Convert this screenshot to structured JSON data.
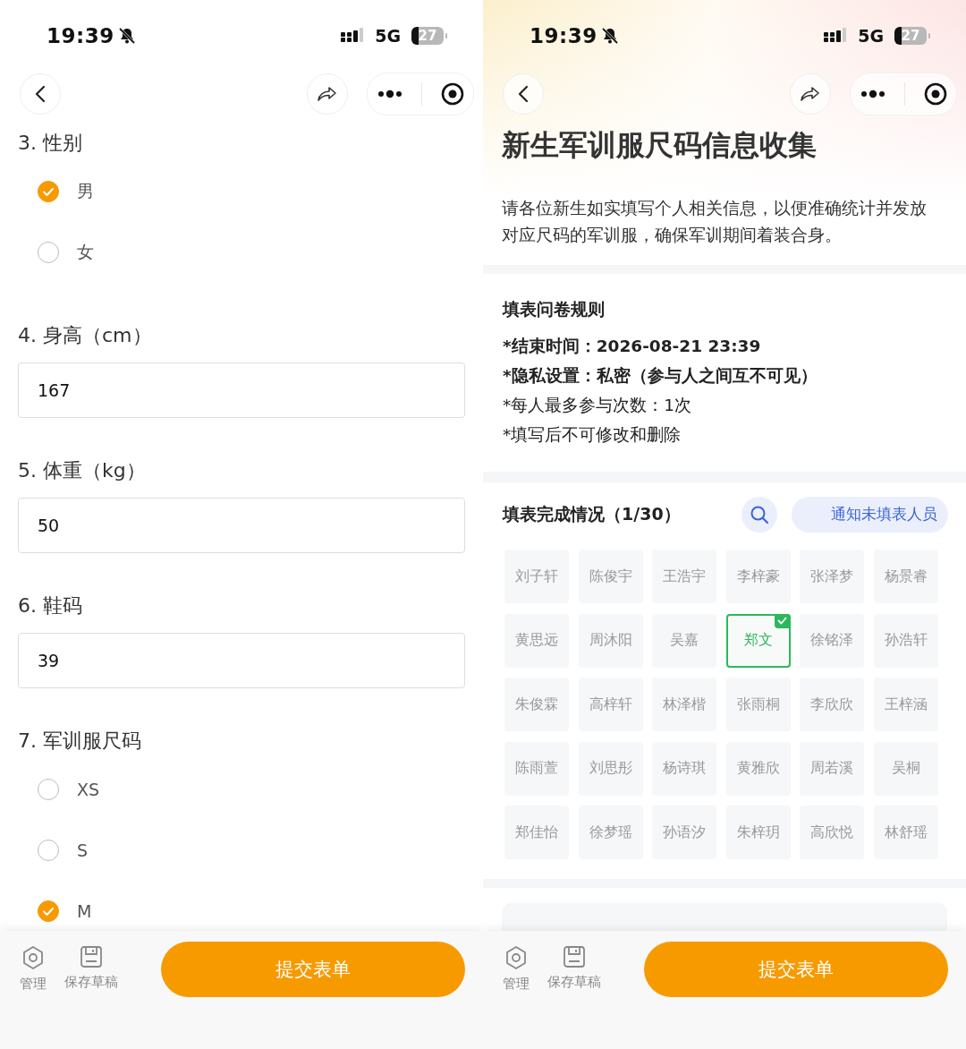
{
  "form_screen": {
    "status_bar": {
      "time": "19:39",
      "network": "5G",
      "battery": "27"
    },
    "questions": [
      {
        "kind": "radio",
        "label": "3. 性别",
        "options": [
          {
            "label": "男",
            "selected": true
          },
          {
            "label": "女",
            "selected": false
          }
        ]
      },
      {
        "kind": "input",
        "label": "4. 身高（cm）",
        "value": "167"
      },
      {
        "kind": "input",
        "label": "5. 体重（kg）",
        "value": "50"
      },
      {
        "kind": "input",
        "label": "6. 鞋码",
        "value": "39"
      },
      {
        "kind": "radio",
        "label": "7. 军训服尺码",
        "options": [
          {
            "label": "XS",
            "selected": false
          },
          {
            "label": "S",
            "selected": false
          },
          {
            "label": "M",
            "selected": true
          }
        ]
      }
    ],
    "bottom_bar": {
      "actions": [
        {
          "kind": "settings",
          "label": "管理"
        },
        {
          "kind": "save",
          "label": "保存草稿"
        }
      ],
      "submit": "提交表单"
    }
  },
  "info_screen": {
    "status_bar": {
      "time": "19:39",
      "network": "5G",
      "battery": "27"
    },
    "title": "新生军训服尺码信息收集",
    "description": "请各位新生如实填写个人相关信息，以便准确统计并发放对应尺码的军训服，确保军训期间着装合身。",
    "rules": {
      "title": "填表问卷规则",
      "items": [
        {
          "label": "*结束时间：",
          "value": "2026-08-21 23:39",
          "bold": true
        },
        {
          "label": "*隐私设置：",
          "value": "私密（参与人之间互不可见）",
          "bold": true
        },
        {
          "label": "*每人最多参与次数：",
          "value": "1次",
          "bold": false
        },
        {
          "label": "*填写后不可修改和删除",
          "value": "",
          "bold": false
        }
      ]
    },
    "completion": {
      "title": "填表完成情况（1/30）",
      "notify_button": "通知未填表人员",
      "people": [
        {
          "name": "刘子轩",
          "submitted": false
        },
        {
          "name": "陈俊宇",
          "submitted": false
        },
        {
          "name": "王浩宇",
          "submitted": false
        },
        {
          "name": "李梓豪",
          "submitted": false
        },
        {
          "name": "张泽梦",
          "submitted": false
        },
        {
          "name": "杨景睿",
          "submitted": false
        },
        {
          "name": "黄思远",
          "submitted": false
        },
        {
          "name": "周沐阳",
          "submitted": false
        },
        {
          "name": "吴嘉",
          "submitted": false
        },
        {
          "name": "郑文",
          "submitted": true
        },
        {
          "name": "徐铭泽",
          "submitted": false
        },
        {
          "name": "孙浩轩",
          "submitted": false
        },
        {
          "name": "朱俊霖",
          "submitted": false
        },
        {
          "name": "高梓轩",
          "submitted": false
        },
        {
          "name": "林泽楷",
          "submitted": false
        },
        {
          "name": "张雨桐",
          "submitted": false
        },
        {
          "name": "李欣欣",
          "submitted": false
        },
        {
          "name": "王梓涵",
          "submitted": false
        },
        {
          "name": "陈雨萱",
          "submitted": false
        },
        {
          "name": "刘思彤",
          "submitted": false
        },
        {
          "name": "杨诗琪",
          "submitted": false
        },
        {
          "name": "黄雅欣",
          "submitted": false
        },
        {
          "name": "周若溪",
          "submitted": false
        },
        {
          "name": "吴桐",
          "submitted": false
        },
        {
          "name": "郑佳怡",
          "submitted": false
        },
        {
          "name": "徐梦瑶",
          "submitted": false
        },
        {
          "name": "孙语汐",
          "submitted": false
        },
        {
          "name": "朱梓玥",
          "submitted": false
        },
        {
          "name": "高欣悦",
          "submitted": false
        },
        {
          "name": "林舒瑶",
          "submitted": false
        }
      ]
    },
    "bottom_bar": {
      "actions": [
        {
          "kind": "settings",
          "label": "管理"
        },
        {
          "kind": "save",
          "label": "保存草稿"
        }
      ],
      "submit": "提交表单"
    }
  }
}
